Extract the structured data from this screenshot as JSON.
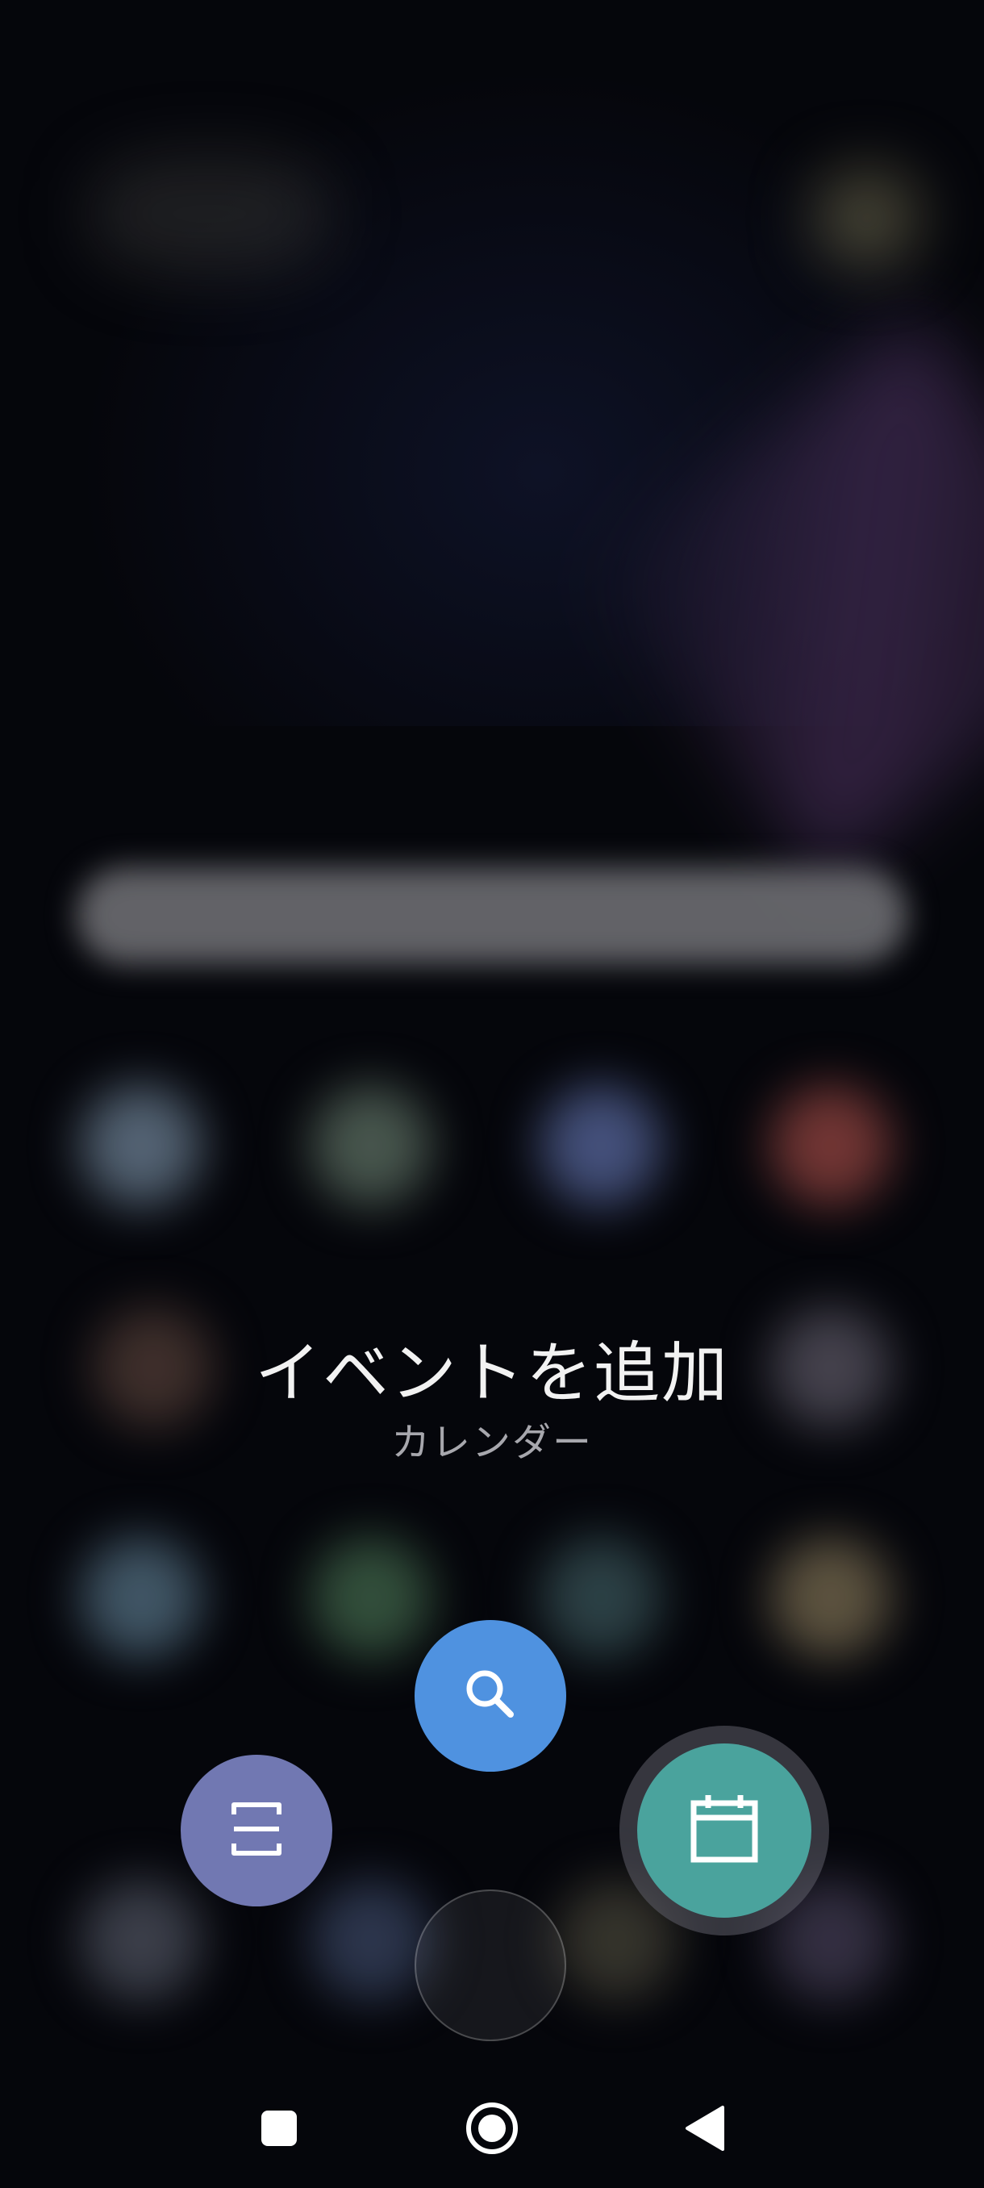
{
  "shortcut": {
    "title": "イベントを追加",
    "app_name": "カレンダー"
  },
  "actions": [
    {
      "icon": "search-icon",
      "color": "#4f92e0"
    },
    {
      "icon": "scan-icon",
      "color": "#7178b2"
    },
    {
      "icon": "calendar-icon",
      "color": "#4aa39d"
    }
  ],
  "navigation": {
    "buttons": [
      "recents-icon",
      "home-icon",
      "back-icon"
    ]
  }
}
